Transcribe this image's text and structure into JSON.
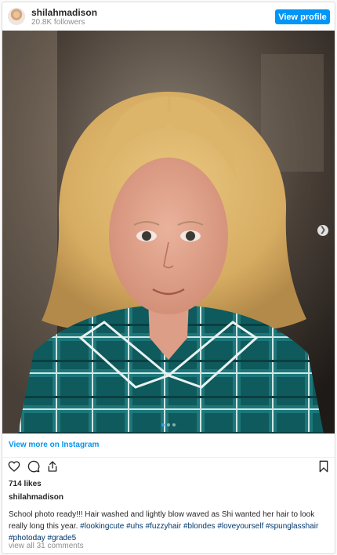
{
  "header": {
    "username": "shilahmadison",
    "followers": "20.8K followers",
    "view_profile_label": "View profile"
  },
  "post": {
    "carousel_slides": 3,
    "active_slide": 1,
    "next_icon": "chevron-right-icon"
  },
  "view_more_label": "View more on Instagram",
  "actions": {
    "icons": [
      "heart-icon",
      "comment-icon",
      "share-icon",
      "bookmark-icon"
    ]
  },
  "likes": "714 likes",
  "caption": {
    "owner": "shilahmadison",
    "text": "School photo ready!!! Hair washed and lightly blow waved as Shi wanted her hair to look really long this year.",
    "hashtags": [
      "#lookingcute",
      "#uhs",
      "#fuzzyhair",
      "#blondes",
      "#loveyourself",
      "#spunglasshair",
      "#photoday",
      "#grade5"
    ]
  },
  "comments_link": "view all 31 comments",
  "colors": {
    "accent": "#0095f6",
    "hashtag": "#00376b",
    "muted": "#8e8e8e"
  }
}
